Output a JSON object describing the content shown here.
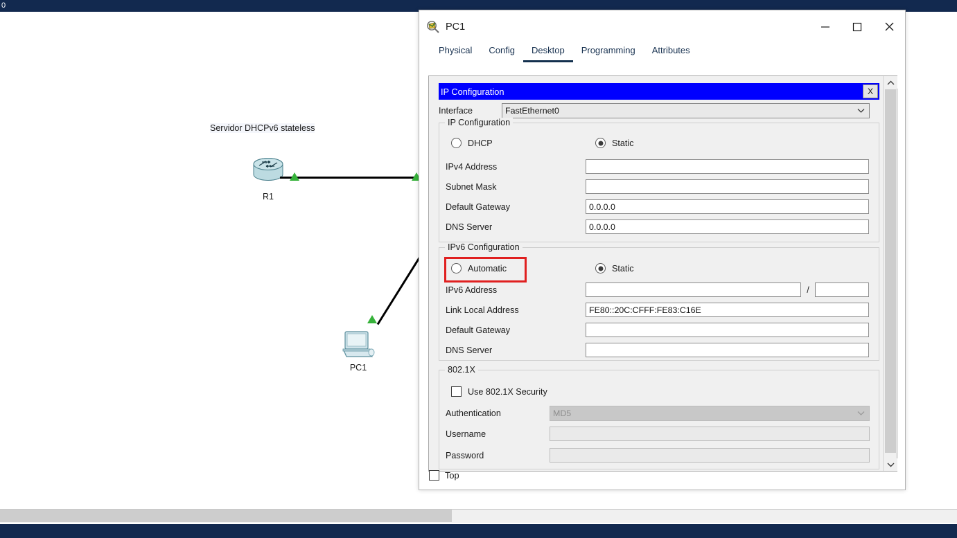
{
  "desktop": {
    "topbar_text": "0"
  },
  "topology": {
    "annotation_label": "Servidor DHCPv6 stateless",
    "devices": [
      {
        "name": "R1",
        "type": "router-icon"
      },
      {
        "name": "PC1",
        "type": "pc-icon"
      }
    ]
  },
  "window": {
    "title": "PC1",
    "icon": "inspect-magnifier-icon",
    "controls": {
      "minimize": "minimize-icon",
      "maximize": "maximize-icon",
      "close": "close-icon"
    },
    "tabs": [
      {
        "label": "Physical",
        "active": false
      },
      {
        "label": "Config",
        "active": false
      },
      {
        "label": "Desktop",
        "active": true
      },
      {
        "label": "Programming",
        "active": false
      },
      {
        "label": "Attributes",
        "active": false
      }
    ],
    "bottom_checkbox": {
      "label": "Top",
      "checked": false
    }
  },
  "ip_config": {
    "header_title": "IP Configuration",
    "close_label": "X",
    "interface": {
      "label": "Interface",
      "value": "FastEthernet0"
    },
    "ipv4": {
      "group_title": "IP Configuration",
      "mode_dhcp": {
        "label": "DHCP",
        "selected": false
      },
      "mode_static": {
        "label": "Static",
        "selected": true
      },
      "fields": [
        {
          "label": "IPv4 Address",
          "value": ""
        },
        {
          "label": "Subnet Mask",
          "value": ""
        },
        {
          "label": "Default Gateway",
          "value": "0.0.0.0"
        },
        {
          "label": "DNS Server",
          "value": "0.0.0.0"
        }
      ]
    },
    "ipv6": {
      "group_title": "IPv6 Configuration",
      "mode_automatic": {
        "label": "Automatic",
        "selected": false,
        "highlighted": true
      },
      "mode_static": {
        "label": "Static",
        "selected": true
      },
      "address": {
        "label": "IPv6 Address",
        "value": "",
        "prefix_separator": "/",
        "prefix_value": ""
      },
      "link_local": {
        "label": "Link Local Address",
        "value": "FE80::20C:CFFF:FE83:C16E"
      },
      "gateway": {
        "label": "Default Gateway",
        "value": ""
      },
      "dns": {
        "label": "DNS Server",
        "value": ""
      }
    },
    "dot1x": {
      "group_title": "802.1X",
      "use_security": {
        "label": "Use 802.1X Security",
        "checked": false
      },
      "authentication": {
        "label": "Authentication",
        "value": "MD5",
        "disabled": true
      },
      "username": {
        "label": "Username",
        "value": "",
        "disabled": true
      },
      "password": {
        "label": "Password",
        "value": "",
        "disabled": true
      }
    }
  },
  "colors": {
    "title_bar_blue": "#0000ff",
    "highlight_red": "#e02020",
    "desktop_navy": "#12294f",
    "link_green": "#36b23a",
    "tab_active": "#13304e"
  }
}
